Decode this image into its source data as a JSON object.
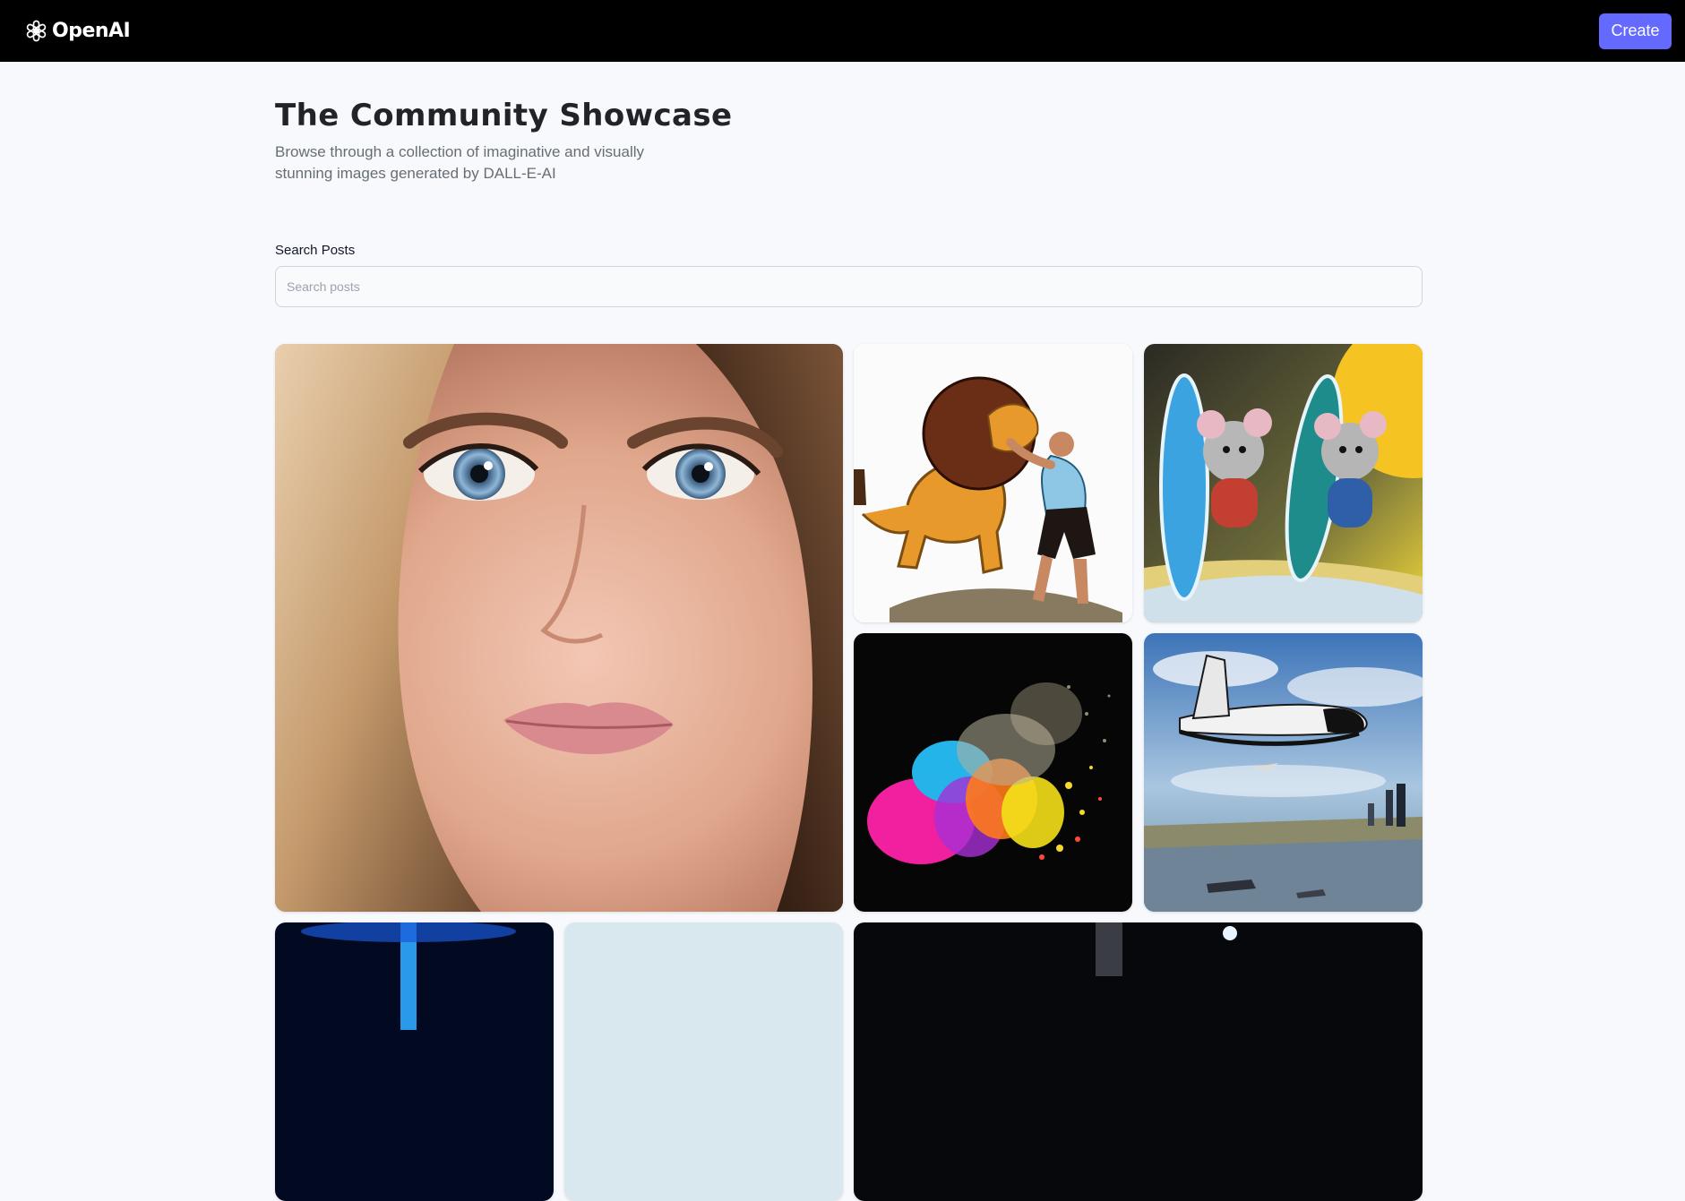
{
  "header": {
    "brand": "OpenAI",
    "logo_icon": "openai-logo-icon",
    "create_label": "Create",
    "accent_color": "#6469ff",
    "background": "#000000"
  },
  "hero": {
    "title": "The Community Showcase",
    "subtitle": "Browse through a collection of imaginative and visually stunning images generated by DALL-E-AI"
  },
  "search": {
    "label": "Search Posts",
    "placeholder": "Search posts",
    "value": ""
  },
  "gallery": {
    "posts": [
      {
        "subject": "portrait-woman-blue-eyes"
      },
      {
        "subject": "man-wrestling-lion"
      },
      {
        "subject": "mice-with-surfboards"
      },
      {
        "subject": "colorful-powder-explosion"
      },
      {
        "subject": "space-shuttle-over-city"
      },
      {
        "subject": "blue-light-tunnel"
      },
      {
        "subject": "pale-sky"
      },
      {
        "subject": "night-scene"
      }
    ]
  }
}
